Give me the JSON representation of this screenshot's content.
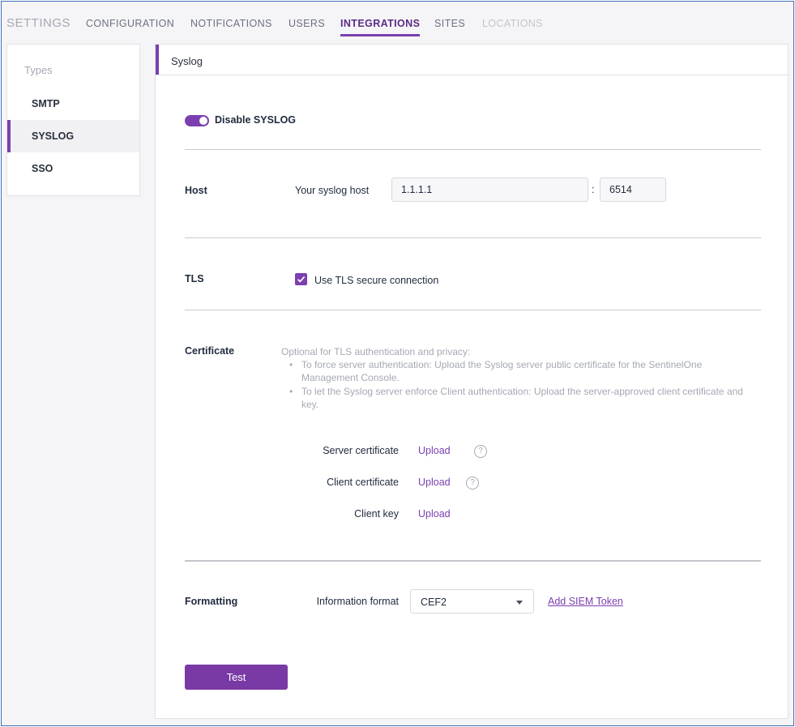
{
  "nav": {
    "title": "SETTINGS",
    "tabs": [
      {
        "label": "CONFIGURATION",
        "state": "normal"
      },
      {
        "label": "NOTIFICATIONS",
        "state": "normal"
      },
      {
        "label": "USERS",
        "state": "normal"
      },
      {
        "label": "INTEGRATIONS",
        "state": "active"
      },
      {
        "label": "SITES",
        "state": "normal"
      },
      {
        "label": "LOCATIONS",
        "state": "disabled"
      }
    ]
  },
  "sidebar": {
    "header": "Types",
    "items": [
      {
        "label": "SMTP",
        "active": false
      },
      {
        "label": "SYSLOG",
        "active": true
      },
      {
        "label": "SSO",
        "active": false
      }
    ]
  },
  "panel": {
    "title": "Syslog",
    "toggle": {
      "label": "Disable SYSLOG",
      "on": true
    },
    "host": {
      "section_label": "Host",
      "field_label": "Your syslog host",
      "host_value": "1.1.1.1",
      "separator": ":",
      "port_value": "6514"
    },
    "tls": {
      "section_label": "TLS",
      "checkbox_label": "Use TLS secure connection",
      "checked": true
    },
    "certificate": {
      "section_label": "Certificate",
      "intro": "Optional for TLS authentication and privacy:",
      "bullets": [
        "To force server authentication: Upload the Syslog server public certificate for the SentinelOne Management Console.",
        "To let the Syslog server enforce Client authentication: Upload the server-approved client certificate and key."
      ],
      "rows": [
        {
          "label": "Server certificate",
          "action": "Upload",
          "help": "?"
        },
        {
          "label": "Client certificate",
          "action": "Upload",
          "help": "?"
        },
        {
          "label": "Client key",
          "action": "Upload"
        }
      ]
    },
    "formatting": {
      "section_label": "Formatting",
      "field_label": "Information format",
      "selected": "CEF2",
      "siem_link": "Add SIEM Token"
    },
    "test_button": "Test"
  },
  "colors": {
    "accent": "#7b3fb0",
    "button": "#7a3aa5",
    "frame_border": "#3d6fb6",
    "muted_text": "#a5a9b3"
  }
}
